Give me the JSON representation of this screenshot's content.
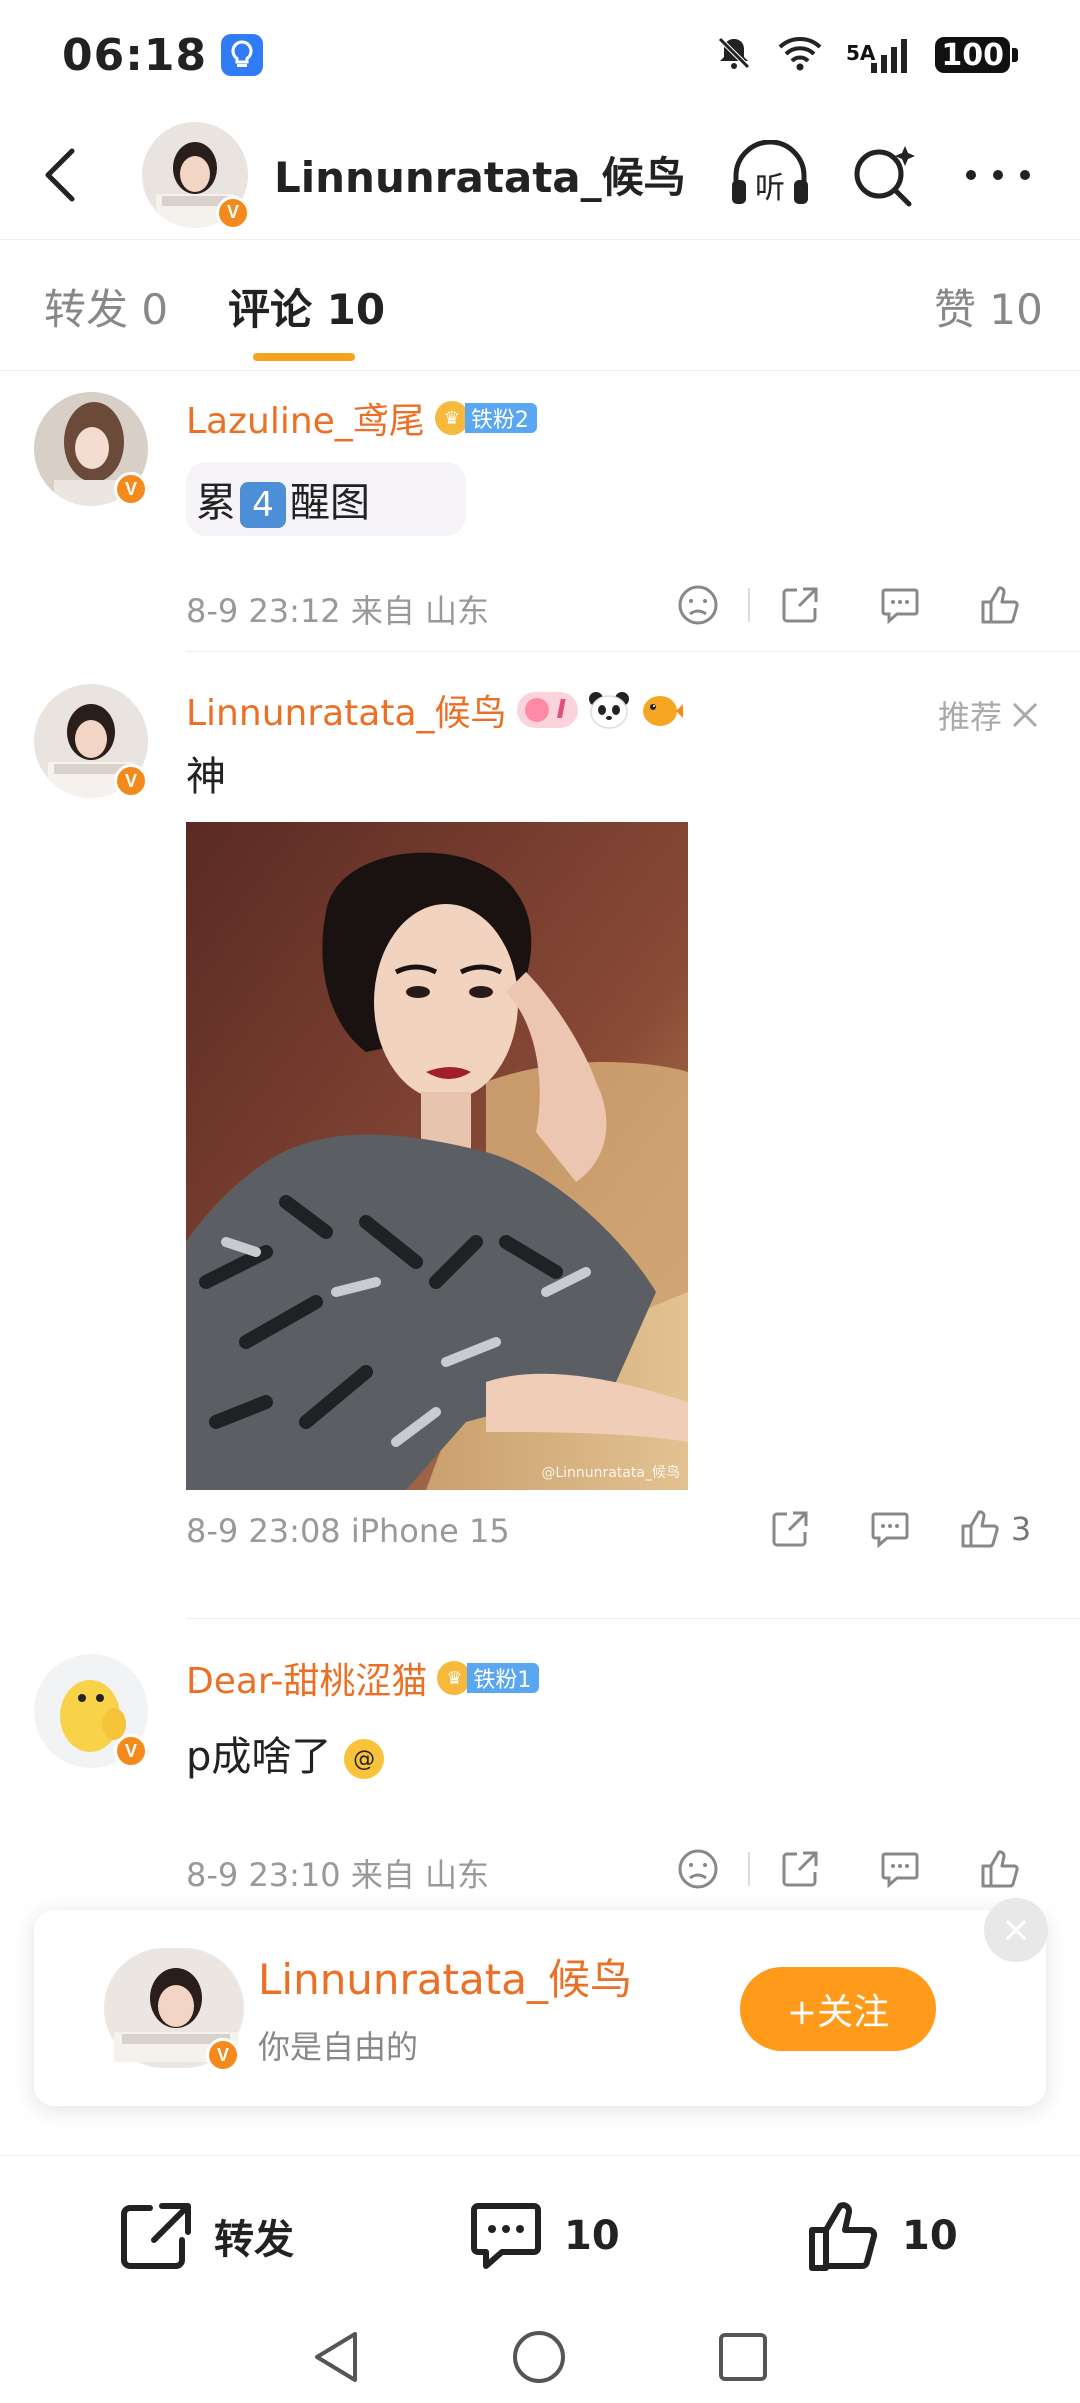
{
  "status_bar": {
    "time": "06:18",
    "network": "5A",
    "battery": "100",
    "icons": [
      "app-notification-icon",
      "mute-bell-icon",
      "wifi-icon",
      "signal-icon",
      "battery-icon"
    ]
  },
  "header": {
    "title": "Linnunratata_候鸟",
    "listen_label": "听",
    "icons": [
      "back-icon",
      "listen-icon",
      "search-icon",
      "more-icon"
    ]
  },
  "tabs": [
    {
      "label": "转发 0"
    },
    {
      "label": "评论 10"
    },
    {
      "label": "赞 10"
    }
  ],
  "comments": [
    {
      "name": "Lazuline_鸢尾",
      "fan_badge": "铁粉2",
      "text_parts": [
        "累",
        "4",
        "醒图"
      ],
      "meta": "8-9 23:12 来自 山东"
    },
    {
      "name": "Linnunratata_候鸟",
      "badge_text": "I",
      "recommend": "推荐",
      "text": "神",
      "image_watermark": "@Linnunratata_候鸟",
      "meta": "8-9 23:08 iPhone 15",
      "like_count": "3"
    },
    {
      "name": "Dear-甜桃涩猫",
      "fan_badge": "铁粉1",
      "text": "p成啥了",
      "meta": "8-9 23:10 来自 山东"
    }
  ],
  "follow_card": {
    "name": "Linnunratata_候鸟",
    "subtitle": "你是自由的",
    "button": "+关注"
  },
  "bottom_bar": {
    "repost": "转发",
    "comment_count": "10",
    "like_count": "10"
  },
  "colors": {
    "accent_orange": "#eb7025",
    "follow_button": "#ff9a1a",
    "tab_underline": "#f5a31c",
    "fan_badge_blue": "#5ba6f0"
  }
}
